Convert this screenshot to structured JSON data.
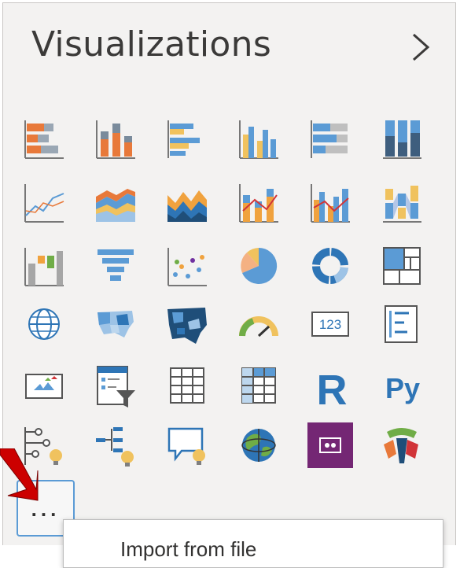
{
  "pane": {
    "title": "Visualizations",
    "expand_icon": "chevron-right-icon"
  },
  "visuals": [
    {
      "name": "stacked-bar-chart-icon"
    },
    {
      "name": "stacked-column-chart-icon"
    },
    {
      "name": "clustered-bar-chart-icon"
    },
    {
      "name": "clustered-column-chart-icon"
    },
    {
      "name": "100-stacked-bar-chart-icon"
    },
    {
      "name": "100-stacked-column-chart-icon"
    },
    {
      "name": "line-chart-icon"
    },
    {
      "name": "area-chart-icon"
    },
    {
      "name": "stacked-area-chart-icon"
    },
    {
      "name": "line-and-stacked-column-chart-icon"
    },
    {
      "name": "line-and-clustered-column-chart-icon"
    },
    {
      "name": "ribbon-chart-icon"
    },
    {
      "name": "waterfall-chart-icon"
    },
    {
      "name": "funnel-icon"
    },
    {
      "name": "scatter-chart-icon"
    },
    {
      "name": "pie-chart-icon"
    },
    {
      "name": "donut-chart-icon"
    },
    {
      "name": "treemap-icon"
    },
    {
      "name": "map-icon"
    },
    {
      "name": "filled-map-icon"
    },
    {
      "name": "shape-map-icon"
    },
    {
      "name": "gauge-icon"
    },
    {
      "name": "card-icon",
      "text": "123"
    },
    {
      "name": "multi-row-card-icon"
    },
    {
      "name": "kpi-icon"
    },
    {
      "name": "slicer-icon"
    },
    {
      "name": "table-icon"
    },
    {
      "name": "matrix-icon"
    },
    {
      "name": "r-script-visual-icon",
      "text": "R"
    },
    {
      "name": "python-visual-icon",
      "text": "Py"
    },
    {
      "name": "key-influencers-icon"
    },
    {
      "name": "decomposition-tree-icon"
    },
    {
      "name": "qa-icon"
    },
    {
      "name": "arcgis-map-icon"
    },
    {
      "name": "power-apps-icon"
    },
    {
      "name": "custom-visual-icon"
    }
  ],
  "more_button": {
    "label": "...",
    "icon": "more-options-icon"
  },
  "tooltip": {
    "label": "Import from file"
  },
  "annotation": {
    "color": "#cc0000"
  }
}
